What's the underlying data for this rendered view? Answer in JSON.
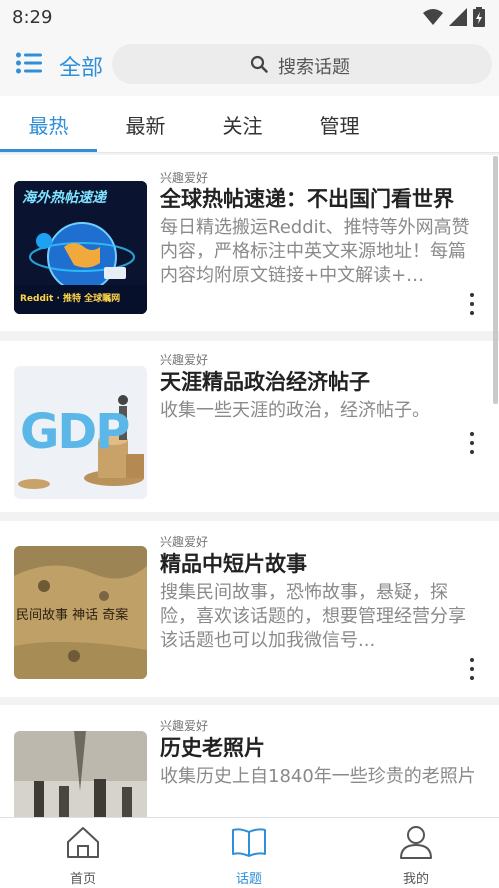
{
  "status_bar": {
    "time": "8:29"
  },
  "header": {
    "scope_label": "全部",
    "search_placeholder": "搜索话题"
  },
  "tabs": [
    {
      "label": "最热",
      "active": true
    },
    {
      "label": "最新",
      "active": false
    },
    {
      "label": "关注",
      "active": false
    },
    {
      "label": "管理",
      "active": false
    }
  ],
  "topics": [
    {
      "category": "兴趣爱好",
      "title": "全球热帖速递：不出国门看世界",
      "description": "每日精选搬运Reddit、推特等外网高赞内容，严格标注中英文来源地址！每篇内容均附原文链接+中文解读+…",
      "thumb": {
        "banner": "海外热帖速递",
        "footer": "Reddit · 推特 全球瞩网"
      }
    },
    {
      "category": "兴趣爱好",
      "title": "天涯精品政治经济帖子",
      "description": "收集一些天涯的政治，经济帖子。",
      "thumb": {
        "text": "GDP"
      }
    },
    {
      "category": "兴趣爱好",
      "title": "精品中短片故事",
      "description": "搜集民间故事，恐怖故事，悬疑，探险，喜欢该话题的，想要管理经营分享该话题也可以加我微信号...",
      "thumb": {
        "text": "民间故事 神话 奇案"
      }
    },
    {
      "category": "兴趣爱好",
      "title": "历史老照片",
      "description": "收集历史上自1840年一些珍贵的老照片",
      "thumb": {}
    }
  ],
  "bottom_nav": [
    {
      "label": "首页",
      "icon": "home-icon",
      "active": false
    },
    {
      "label": "话题",
      "icon": "book-icon",
      "active": true
    },
    {
      "label": "我的",
      "icon": "profile-icon",
      "active": false
    }
  ],
  "colors": {
    "accent": "#2f8fd8",
    "title": "#222222",
    "muted": "#8a8a8a"
  }
}
